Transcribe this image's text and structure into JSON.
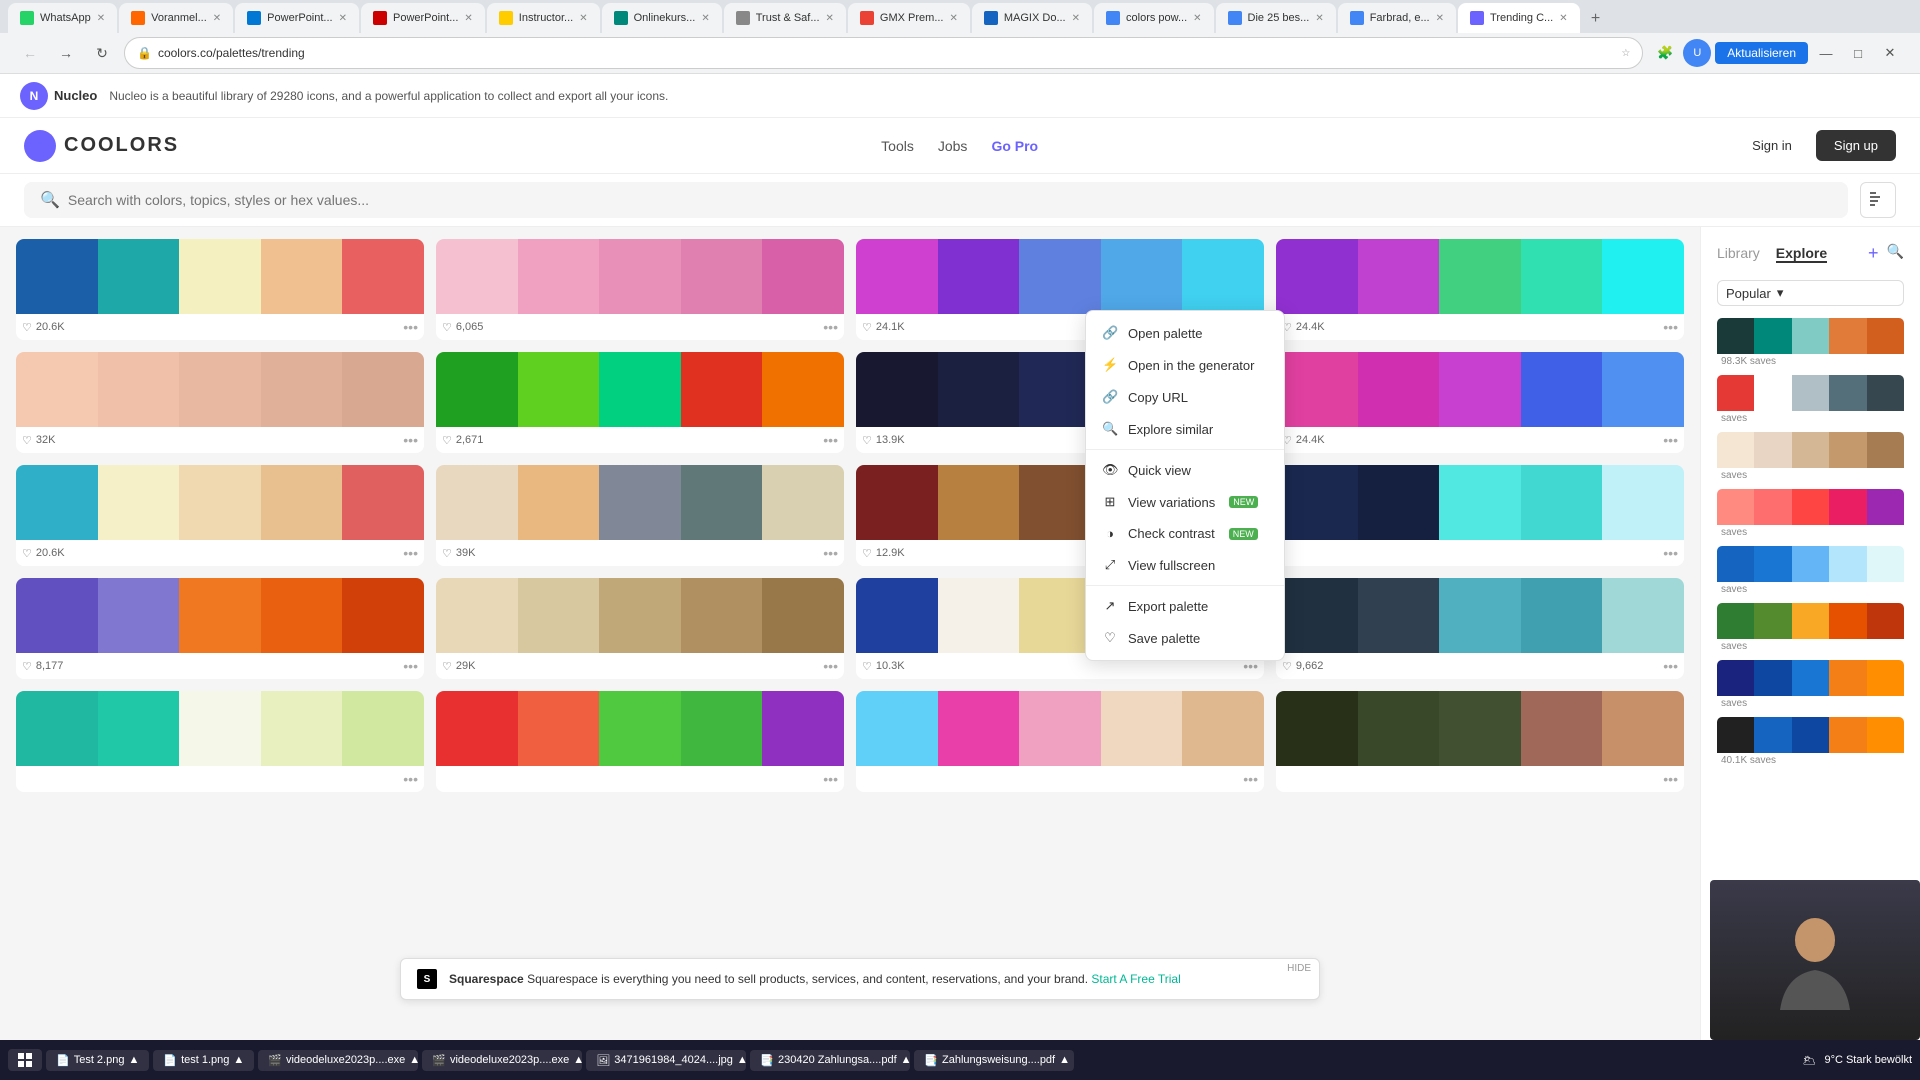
{
  "browser": {
    "tabs": [
      {
        "id": "tab-whatsapp",
        "label": "WhatsApp",
        "fav": "fav-green",
        "active": false
      },
      {
        "id": "tab-voranmel",
        "label": "Voranmel...",
        "fav": "fav-orange",
        "active": false
      },
      {
        "id": "tab-powerpoint1",
        "label": "PowerPoint...",
        "fav": "fav-blue",
        "active": false
      },
      {
        "id": "tab-powerpoint2",
        "label": "PowerPoint...",
        "fav": "fav-red",
        "active": false
      },
      {
        "id": "tab-instructor",
        "label": "Instructor...",
        "fav": "fav-yellow",
        "active": false
      },
      {
        "id": "tab-onlinekurs",
        "label": "Onlinekurs...",
        "fav": "fav-teal",
        "active": false
      },
      {
        "id": "tab-trust",
        "label": "Trust & Saf...",
        "fav": "fav-gray",
        "active": false
      },
      {
        "id": "tab-gmx",
        "label": "GMX Prem...",
        "fav": "fav-mail",
        "active": false
      },
      {
        "id": "tab-magix",
        "label": "MAGIX Do...",
        "fav": "fav-magix",
        "active": false
      },
      {
        "id": "tab-colors",
        "label": "colors pow...",
        "fav": "fav-search",
        "active": false
      },
      {
        "id": "tab-die25",
        "label": "Die 25 bes...",
        "fav": "fav-search",
        "active": false
      },
      {
        "id": "tab-farbrad",
        "label": "Farbrad, e...",
        "fav": "fav-search",
        "active": false
      },
      {
        "id": "tab-trending",
        "label": "Trending C...",
        "fav": "fav-coolors",
        "active": true
      }
    ],
    "url": "coolors.co/palettes/trending",
    "aktualisieren_label": "Aktualisieren"
  },
  "promo": {
    "icon_text": "N",
    "title": "Nucleo",
    "description": "Nucleo is a beautiful library of 29280 icons, and a powerful application to collect and export all your icons."
  },
  "header": {
    "logo": "coolors",
    "nav_items": [
      "Tools",
      "Jobs",
      "Go Pro"
    ],
    "sign_in": "Sign in",
    "sign_up": "Sign up"
  },
  "search": {
    "placeholder": "Search with colors, topics, styles or hex values..."
  },
  "sidebar_panel": {
    "tabs": [
      "Library",
      "Explore"
    ],
    "active_tab": "Explore",
    "popular_label": "Popular",
    "add_label": "+",
    "search_label": "🔍",
    "mini_palettes": [
      {
        "saves": "98.3K saves",
        "colors": [
          "#1a3a3a",
          "#00897b",
          "#80cbc4",
          "#e07b39",
          "#d35f1e"
        ]
      },
      {
        "saves": "saves",
        "colors": [
          "#e53935",
          "#ffffff",
          "#b0bec5",
          "#546e7a",
          "#37474f"
        ]
      },
      {
        "saves": "saves",
        "colors": [
          "#f5e6d3",
          "#e8d5c4",
          "#d4b896",
          "#c49a6c",
          "#a67c52"
        ]
      },
      {
        "saves": "saves",
        "colors": [
          "#ff8a80",
          "#ff6e6e",
          "#ff4444",
          "#e91e63",
          "#9c27b0"
        ]
      },
      {
        "saves": "saves",
        "colors": [
          "#1565c0",
          "#1976d2",
          "#64b5f6",
          "#b3e5fc",
          "#e0f7fa"
        ]
      },
      {
        "saves": "saves",
        "colors": [
          "#2e7d32",
          "#558b2f",
          "#f9a825",
          "#e65100",
          "#bf360c"
        ]
      },
      {
        "saves": "saves",
        "colors": [
          "#1a237e",
          "#0d47a1",
          "#1976d2",
          "#f57f17",
          "#ff8f00"
        ]
      },
      {
        "saves": "40.1K saves",
        "colors": [
          "#212121",
          "#1565c0",
          "#0d47a1",
          "#f57f17",
          "#ff8f00"
        ]
      }
    ]
  },
  "context_menu": {
    "items": [
      {
        "id": "open-palette",
        "icon": "🔗",
        "label": "Open palette",
        "badge": null
      },
      {
        "id": "open-generator",
        "icon": "⚡",
        "label": "Open in the generator",
        "badge": null
      },
      {
        "id": "copy-url",
        "icon": "🔗",
        "label": "Copy URL",
        "badge": null
      },
      {
        "id": "explore-similar",
        "icon": "🔍",
        "label": "Explore similar",
        "badge": null
      },
      {
        "id": "divider1",
        "type": "divider"
      },
      {
        "id": "quick-view",
        "icon": "👁",
        "label": "Quick view",
        "badge": null
      },
      {
        "id": "view-variations",
        "icon": "⊞",
        "label": "View variations",
        "badge": "NEW"
      },
      {
        "id": "check-contrast",
        "icon": "◑",
        "label": "Check contrast",
        "badge": "NEW"
      },
      {
        "id": "view-fullscreen",
        "icon": "⤢",
        "label": "View fullscreen",
        "badge": null
      },
      {
        "id": "divider2",
        "type": "divider"
      },
      {
        "id": "export-palette",
        "icon": "↗",
        "label": "Export palette",
        "badge": null
      },
      {
        "id": "save-palette",
        "icon": "♡",
        "label": "Save palette",
        "badge": null
      }
    ]
  },
  "palettes": {
    "rows": [
      {
        "row_id": "row1",
        "cards": [
          {
            "id": "p1",
            "likes": "20.6K",
            "colors": [
              "#1a5fa8",
              "#1fa8a8",
              "#f5f0c0",
              "#f0c090",
              "#e86060"
            ]
          },
          {
            "id": "p2",
            "likes": "6,065",
            "colors": [
              "#f5c0d0",
              "#f0a0c0",
              "#e890b8",
              "#e080b0",
              "#d860a8"
            ]
          },
          {
            "id": "p3",
            "likes": "24.1K",
            "colors": [
              "#d040d0",
              "#8030d0",
              "#6080e0",
              "#50a8e8",
              "#40d0f0"
            ]
          },
          {
            "id": "p4",
            "likes": "24.4K",
            "colors": [
              "#9030d0",
              "#c040d0",
              "#40d080",
              "#30e0b0",
              "#20f0f0"
            ]
          }
        ]
      },
      {
        "row_id": "row2",
        "cards": [
          {
            "id": "p5",
            "likes": "32K",
            "colors": [
              "#f5c8b0",
              "#f0c0a8",
              "#e8b8a0",
              "#e0b098",
              "#d8a890"
            ]
          },
          {
            "id": "p6",
            "likes": "2,671",
            "colors": [
              "#20a020",
              "#60d020",
              "#00d080",
              "#e03020",
              "#f07000"
            ]
          },
          {
            "id": "p7",
            "likes": "13.9K",
            "colors": [
              "#181830",
              "#1c2040",
              "#202855",
              "#f0c010",
              "#f0d010"
            ]
          },
          {
            "id": "p8",
            "likes": "24.4K",
            "colors": [
              "#e040a0",
              "#d030b0",
              "#c840d0",
              "#4060e8",
              "#5090f0"
            ]
          }
        ]
      },
      {
        "row_id": "row3",
        "cards": [
          {
            "id": "p9",
            "likes": "20.6K",
            "colors": [
              "#30b0c8",
              "#f5f0c8",
              "#f0d8b0",
              "#e8c090",
              "#e06060"
            ]
          },
          {
            "id": "p10",
            "likes": "39K",
            "colors": [
              "#e8d8c0",
              "#e8b880",
              "#808898",
              "#607878",
              "#d8d0b0"
            ]
          },
          {
            "id": "p11",
            "likes": "12.9K",
            "colors": [
              "#7a2020",
              "#b88040",
              "#805030",
              "#c09040",
              "#e8d898"
            ]
          },
          {
            "id": "p12",
            "likes": "",
            "colors": [
              "#1a2850",
              "#152040",
              "#50e8e0",
              "#40d8d0",
              "#c0f0f8"
            ]
          }
        ]
      },
      {
        "row_id": "row4",
        "cards": [
          {
            "id": "p13",
            "likes": "8,177",
            "colors": [
              "#6050c0",
              "#8078d0",
              "#f07820",
              "#e86010",
              "#d04008"
            ]
          },
          {
            "id": "p14",
            "likes": "29K",
            "colors": [
              "#e8d8b8",
              "#d8c8a0",
              "#c0a878",
              "#b09060",
              "#987848"
            ]
          },
          {
            "id": "p15",
            "likes": "10.3K",
            "colors": [
              "#2040a0",
              "#f5f0e8",
              "#e8d898",
              "#e85020",
              "#c04010"
            ]
          },
          {
            "id": "p16",
            "likes": "9,662",
            "colors": [
              "#203040",
              "#304050",
              "#50b0c0",
              "#40a0b0",
              "#a0d8d8"
            ]
          }
        ]
      },
      {
        "row_id": "row5",
        "cards": [
          {
            "id": "p17",
            "likes": "",
            "colors": [
              "#20b8a0",
              "#20c8a8",
              "#f5f8e8",
              "#e8f0c0",
              "#d0e8a0"
            ]
          },
          {
            "id": "p18",
            "likes": "",
            "colors": [
              "#e83030",
              "#f06040",
              "#50c840",
              "#40b840",
              "#9030c0"
            ]
          },
          {
            "id": "p19",
            "likes": "",
            "colors": [
              "#60d0f8",
              "#e840a8",
              "#f0a0c0",
              "#f0d8c0",
              "#e0b890"
            ]
          },
          {
            "id": "p20",
            "likes": "",
            "colors": [
              "#283018",
              "#384828",
              "#405030",
              "#a06858",
              "#c89068"
            ]
          }
        ]
      }
    ]
  },
  "ad": {
    "brand": "Squarespace",
    "text": "Squarespace is everything you need to sell products, services, and content, reservations, and your brand.",
    "cta": "Start A Free Trial",
    "hide": "HIDE"
  },
  "taskbar": {
    "items": [
      {
        "id": "tb-test2",
        "icon": "📄",
        "label": "Test 2.png",
        "arrow": "▲"
      },
      {
        "id": "tb-test1",
        "icon": "📄",
        "label": "test 1.png",
        "arrow": "▲"
      },
      {
        "id": "tb-video1",
        "icon": "🎬",
        "label": "videodeluxe2023p....exe",
        "arrow": "▲"
      },
      {
        "id": "tb-video2",
        "icon": "🎬",
        "label": "videodeluxe2023p....exe",
        "arrow": "▲"
      },
      {
        "id": "tb-img",
        "icon": "🖼",
        "label": "3471961984_4024....jpg",
        "arrow": "▲"
      },
      {
        "id": "tb-pdf1",
        "icon": "📑",
        "label": "230420 Zahlungsa....pdf",
        "arrow": "▲"
      },
      {
        "id": "tb-pdf2",
        "icon": "📑",
        "label": "Zahlungsweisung....pdf",
        "arrow": "▲"
      }
    ],
    "weather": "9°C Stark bewölkt",
    "time_area": "🌥"
  }
}
